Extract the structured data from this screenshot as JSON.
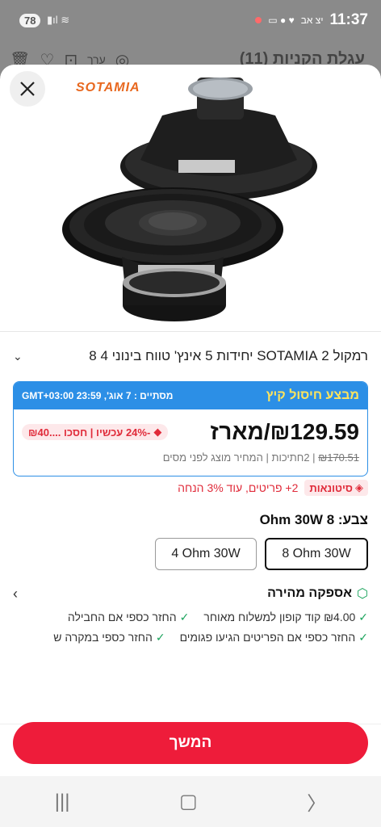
{
  "status_bar": {
    "battery_badge": "78",
    "time": "11:37",
    "carrier_text": "יצ אב"
  },
  "background": {
    "title": "עגלת הקניות (11)",
    "edit_label": "ערך"
  },
  "product": {
    "brand": "SOTAMIA",
    "title": "רמקול 2 SOTAMIA יחידות 5 אינץ' טווח בינוני 4 8"
  },
  "deal": {
    "name": "מבצע חיסול קיץ",
    "ends": "מסתיים : 7 אוג', 23:59 GMT+03:00",
    "price": "₪129.59/מארז",
    "discount": "-24% עכשיו | חסכו ....₪40",
    "original_price": "₪170.51",
    "units": "2חתיכות",
    "price_note": "המחיר מוצג לפני מסים"
  },
  "promo": {
    "tag": "סיטונאות",
    "text": "2+ פריטים, עוד 3% הנחה"
  },
  "color": {
    "label": "צבע:",
    "selected_value": "8 Ohm 30W",
    "options": [
      "8 Ohm 30W",
      "4 Ohm 30W"
    ]
  },
  "shipping": {
    "title": "אספקה מהירה",
    "items": [
      "₪4.00 קוד קופון למשלוח מאוחר",
      "החזר כספי אם החבילה",
      "החזר כספי אם הפריטים הגיעו פגומים",
      "החזר כספי במקרה ש"
    ]
  },
  "cta": {
    "label": "המשך"
  },
  "colors": {
    "accent_red": "#ee1c3a",
    "deal_blue": "#2c8fe6",
    "deal_yellow": "#ffe45c",
    "brand_orange": "#e8681f",
    "check_green": "#19a35b"
  }
}
